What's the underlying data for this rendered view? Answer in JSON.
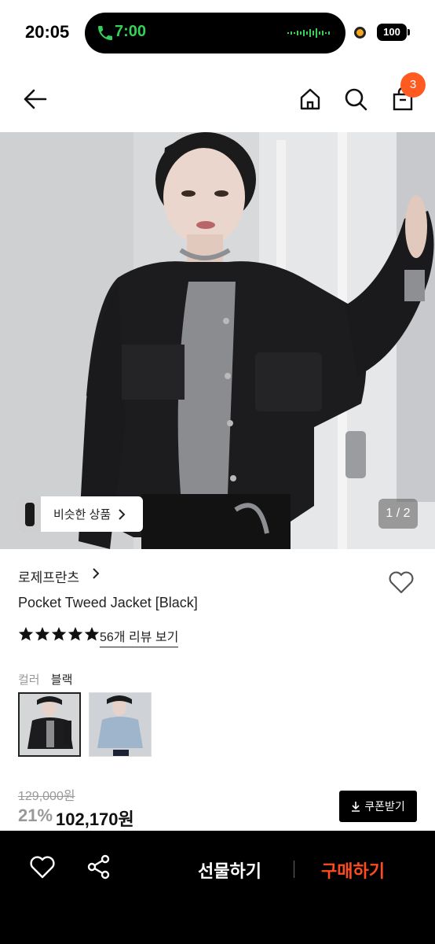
{
  "status_bar": {
    "time": "20:05",
    "call_time": "7:00",
    "battery": "100"
  },
  "header": {
    "cart_count": "3",
    "icons": [
      "back-arrow-icon",
      "home-icon",
      "search-icon",
      "shopping-bag-icon"
    ]
  },
  "gallery": {
    "similar_label": "비슷한 상품",
    "page_indicator": "1 / 2"
  },
  "product": {
    "brand": "로제프란츠",
    "name": "Pocket Tweed Jacket [Black]",
    "rating_stars": 5,
    "review_link": "56개 리뷰 보기",
    "color_label": "컬러",
    "color_value": "블랙",
    "swatches": [
      "black",
      "light-blue"
    ],
    "original_price": "129,000원",
    "discount": "21%",
    "price": "102,170원",
    "coupon_label": "쿠폰받기"
  },
  "bottom_bar": {
    "gift_label": "선물하기",
    "buy_label": "구매하기"
  },
  "colors": {
    "accent": "#ff5a1f",
    "buy_text": "#ff4b1f",
    "bottom_bar_bg": "#000000"
  }
}
